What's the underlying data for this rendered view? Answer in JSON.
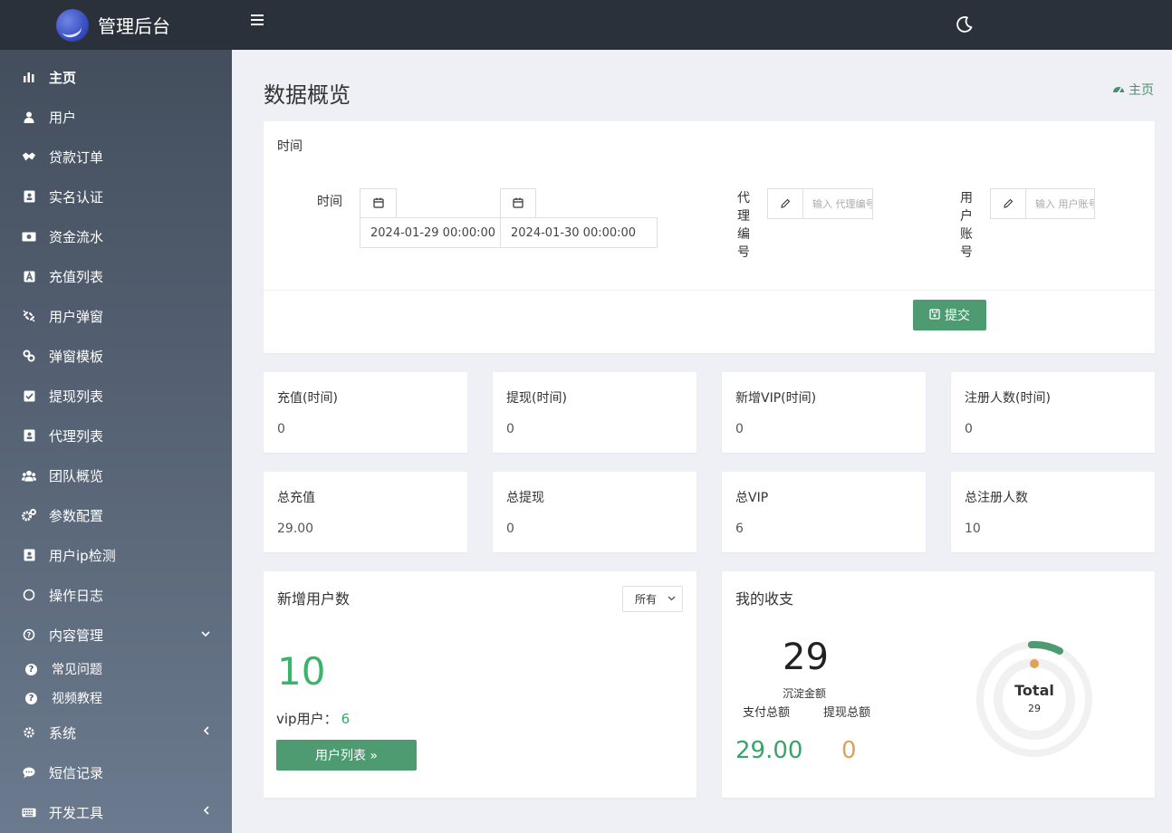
{
  "brand": {
    "title": "管理后台"
  },
  "sidebar": {
    "items": [
      {
        "label": "主页",
        "icon": "bar-chart-icon",
        "active": true
      },
      {
        "label": "用户",
        "icon": "user-icon"
      },
      {
        "label": "贷款订单",
        "icon": "handshake-icon"
      },
      {
        "label": "实名认证",
        "icon": "id-card-icon"
      },
      {
        "label": "资金流水",
        "icon": "money-icon"
      },
      {
        "label": "充值列表",
        "icon": "letter-a-icon"
      },
      {
        "label": "用户弹窗",
        "icon": "unlink-icon"
      },
      {
        "label": "弹窗模板",
        "icon": "link-icon"
      },
      {
        "label": "提现列表",
        "icon": "check-square-icon"
      },
      {
        "label": "代理列表",
        "icon": "address-book-icon"
      },
      {
        "label": "团队概览",
        "icon": "users-icon"
      },
      {
        "label": "参数配置",
        "icon": "cogs-icon"
      },
      {
        "label": "用户ip检测",
        "icon": "address-book-icon"
      },
      {
        "label": "操作日志",
        "icon": "circle-icon"
      },
      {
        "label": "内容管理",
        "icon": "question-circle-icon"
      }
    ],
    "sub_items": [
      {
        "label": "常见问题",
        "icon": "question-icon"
      },
      {
        "label": "视频教程",
        "icon": "question-icon"
      }
    ],
    "bottom_items": [
      {
        "label": "系统",
        "icon": "gear-icon"
      },
      {
        "label": "短信记录",
        "icon": "comment-icon"
      },
      {
        "label": "开发工具",
        "icon": "keyboard-icon"
      }
    ]
  },
  "page": {
    "title": "数据概览",
    "breadcrumb": "主页"
  },
  "filter": {
    "section_title": "时间",
    "time_label": "时间",
    "start_time": "2024-01-29 00:00:00",
    "end_time": "2024-01-30 00:00:00",
    "agent_label_chars": [
      "代",
      "理",
      "编",
      "号"
    ],
    "agent_placeholder": "输入 代理编号",
    "user_label_chars": [
      "用",
      "户",
      "账",
      "号"
    ],
    "user_placeholder": "输入 用户账号",
    "submit_label": "提交"
  },
  "stats_period": [
    {
      "label": "充值(时间)",
      "value": "0"
    },
    {
      "label": "提现(时间)",
      "value": "0"
    },
    {
      "label": "新增VIP(时间)",
      "value": "0"
    },
    {
      "label": "注册人数(时间)",
      "value": "0"
    }
  ],
  "stats_total": [
    {
      "label": "总充值",
      "value": "29.00"
    },
    {
      "label": "总提现",
      "value": "0"
    },
    {
      "label": "总VIP",
      "value": "6"
    },
    {
      "label": "总注册人数",
      "value": "10"
    }
  ],
  "new_users": {
    "title": "新增用户数",
    "select_value": "所有",
    "count": "10",
    "vip_label": "vip用户：",
    "vip_count": "6",
    "button_label": "用户列表 »"
  },
  "finance": {
    "title": "我的收支",
    "balance": "29",
    "balance_label": "沉淀金额",
    "pay_label": "支付总额",
    "withdraw_label": "提现总额",
    "pay_value": "29.00",
    "withdraw_value": "0",
    "donut_title": "Total",
    "donut_value": "29"
  },
  "colors": {
    "accent_green": "#4e9a71",
    "value_green": "#3ab46a",
    "value_orange": "#e0a15a",
    "topbar": "#2b313a"
  }
}
